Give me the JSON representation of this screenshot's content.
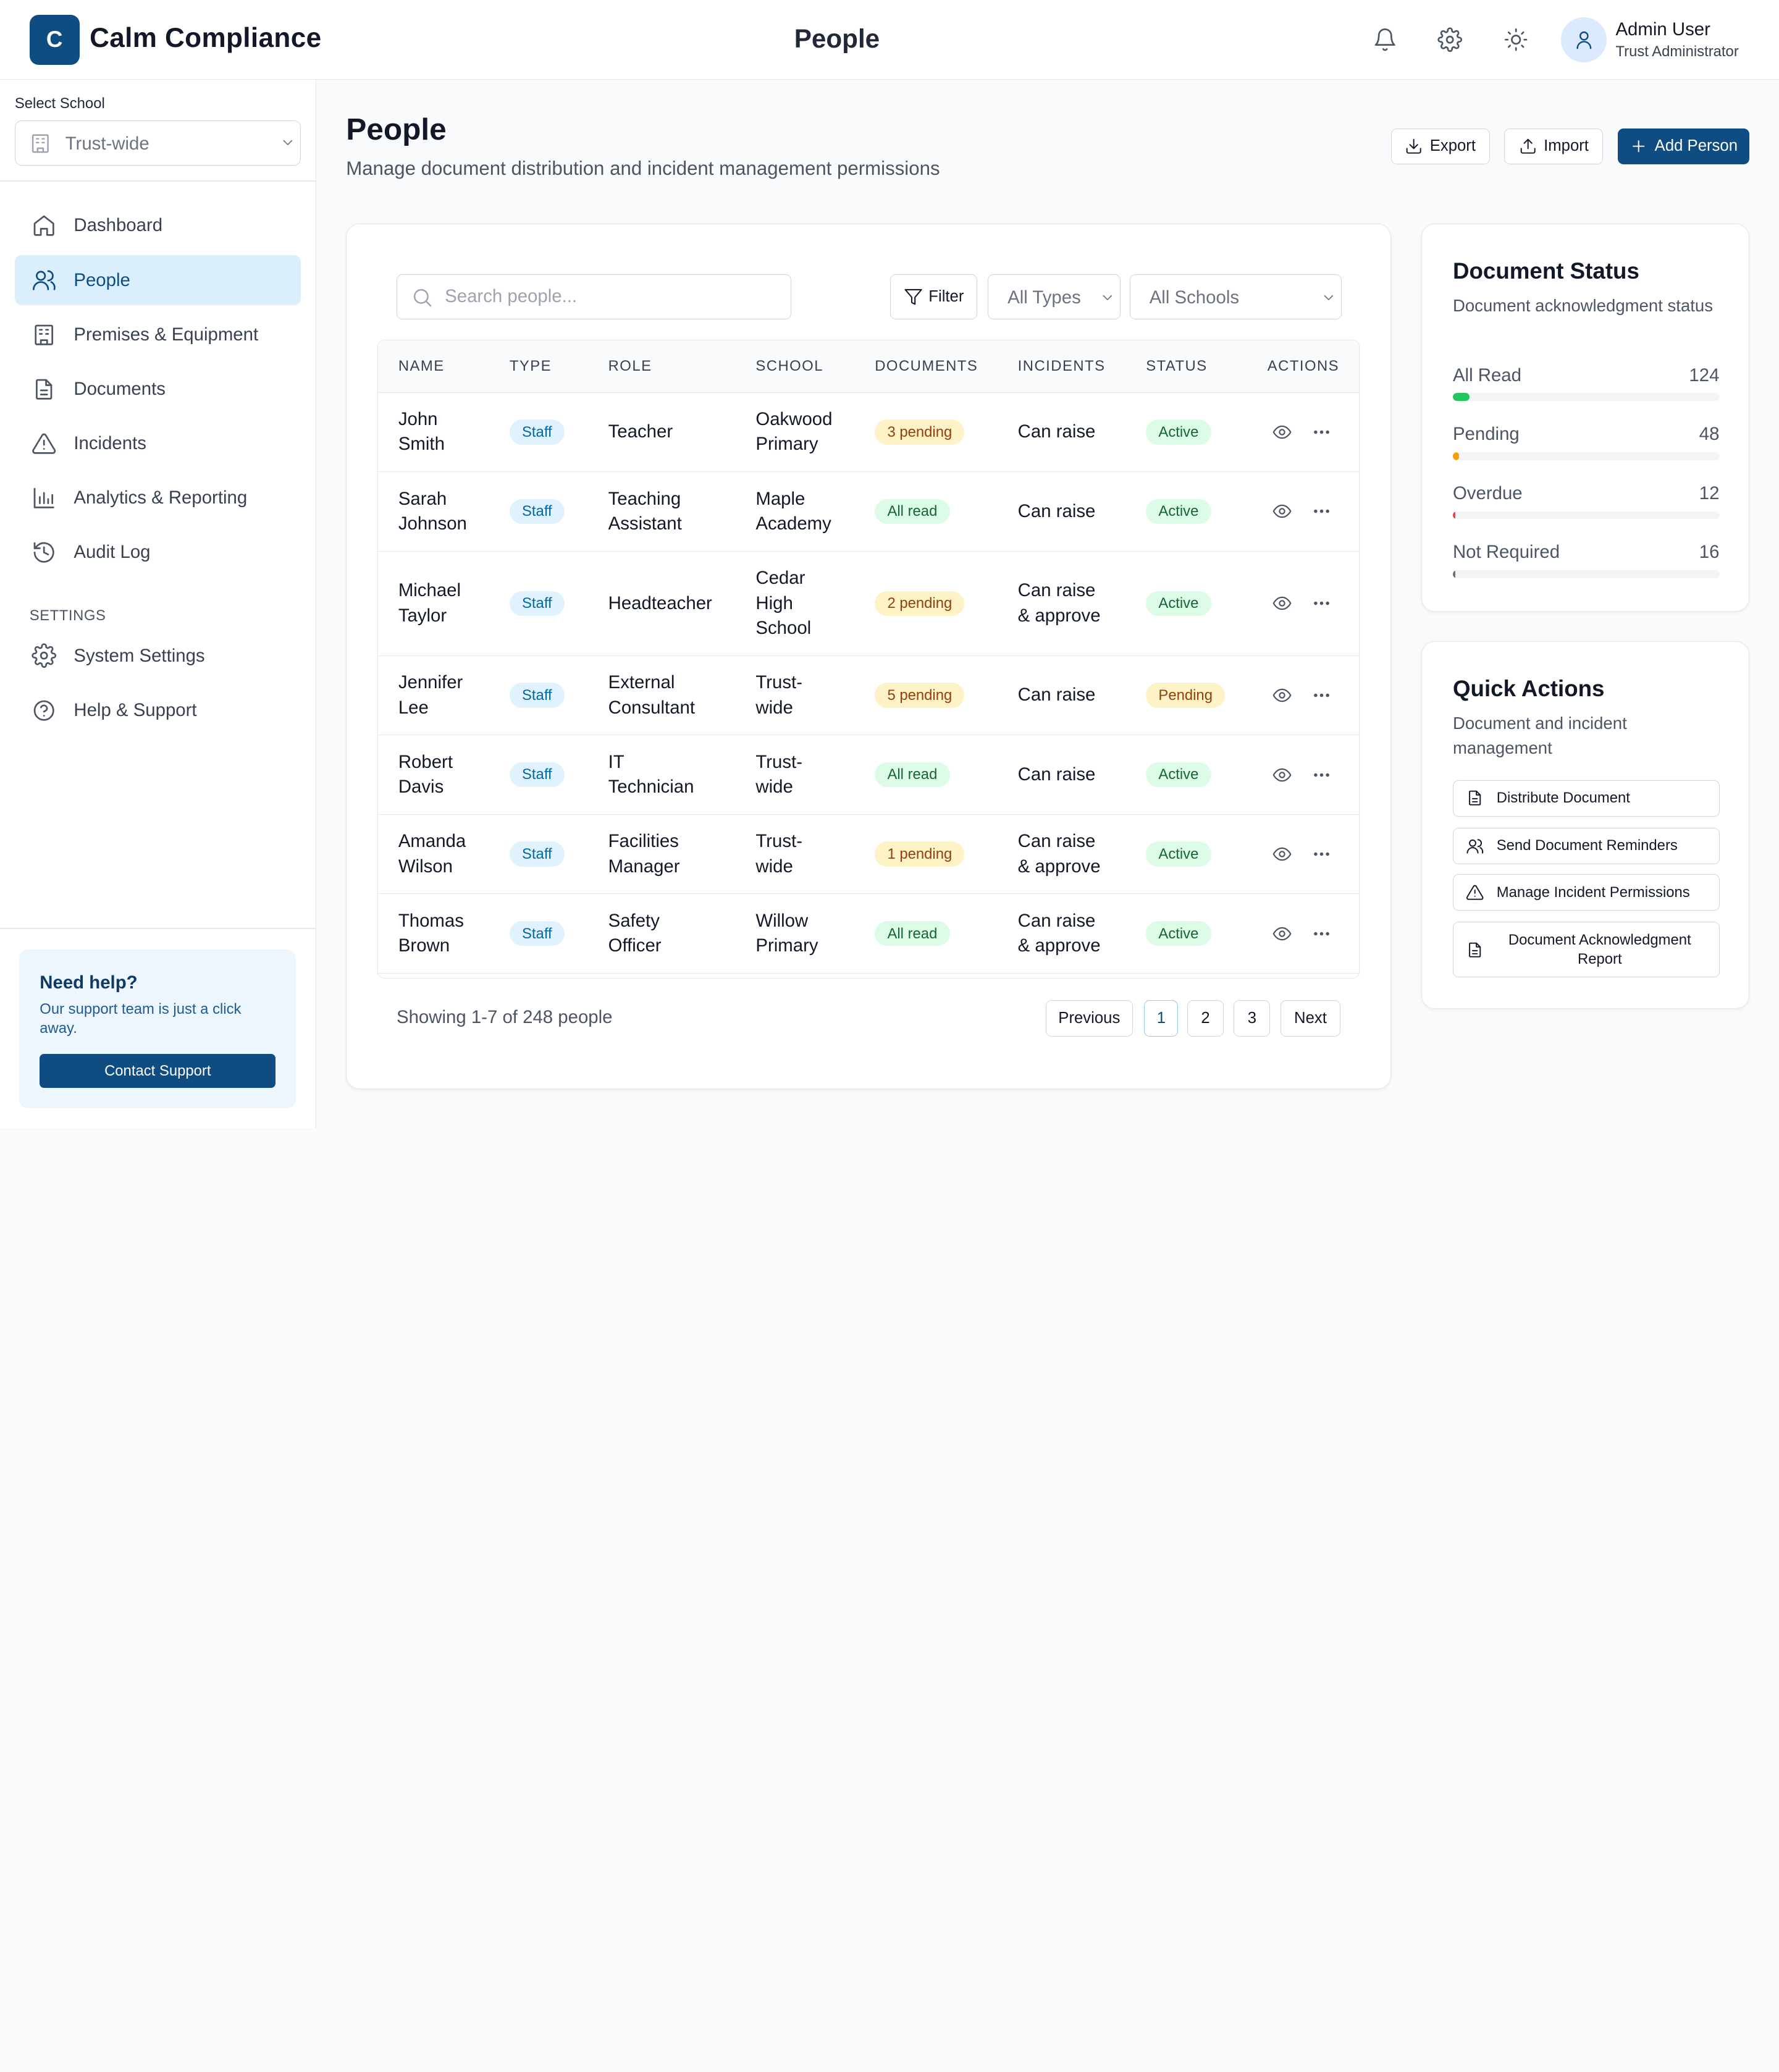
{
  "app": {
    "logo_letter": "C",
    "name": "Calm Compliance",
    "header_title": "People"
  },
  "user": {
    "name": "Admin User",
    "role": "Trust Administrator"
  },
  "sidebar": {
    "select_label": "Select School",
    "school_value": "Trust-wide",
    "nav": [
      {
        "label": "Dashboard",
        "icon": "home-icon",
        "active": false
      },
      {
        "label": "People",
        "icon": "users-icon",
        "active": true
      },
      {
        "label": "Premises & Equipment",
        "icon": "building-icon",
        "active": false
      },
      {
        "label": "Documents",
        "icon": "document-icon",
        "active": false
      },
      {
        "label": "Incidents",
        "icon": "warning-icon",
        "active": false
      },
      {
        "label": "Analytics & Reporting",
        "icon": "bar-chart-icon",
        "active": false
      },
      {
        "label": "Audit Log",
        "icon": "history-icon",
        "active": false
      }
    ],
    "settings_heading": "SETTINGS",
    "settings_nav": [
      {
        "label": "System Settings",
        "icon": "gear-icon"
      },
      {
        "label": "Help & Support",
        "icon": "help-icon"
      }
    ],
    "help": {
      "title": "Need help?",
      "text": "Our support team is just a click away.",
      "button": "Contact Support"
    }
  },
  "main": {
    "title": "People",
    "subtitle": "Manage document distribution and incident management permissions",
    "buttons": {
      "export": "Export",
      "import": "Import",
      "add": "Add Person"
    }
  },
  "table": {
    "search_placeholder": "Search people...",
    "filter_label": "Filter",
    "type_filter": "All Types",
    "school_filter": "All Schools",
    "headers": [
      "NAME",
      "TYPE",
      "ROLE",
      "SCHOOL",
      "DOCUMENTS",
      "INCIDENTS",
      "STATUS",
      "ACTIONS"
    ],
    "rows": [
      {
        "name": [
          "John",
          "Smith"
        ],
        "type": "Staff",
        "role": [
          "Teacher"
        ],
        "school": [
          "Oakwood",
          "Primary"
        ],
        "documents": "3 pending",
        "doc_state": "pending",
        "incidents": [
          "Can raise"
        ],
        "status": "Active"
      },
      {
        "name": [
          "Sarah",
          "Johnson"
        ],
        "type": "Staff",
        "role": [
          "Teaching",
          "Assistant"
        ],
        "school": [
          "Maple",
          "Academy"
        ],
        "documents": "All read",
        "doc_state": "read",
        "incidents": [
          "Can raise"
        ],
        "status": "Active"
      },
      {
        "name": [
          "Michael",
          "Taylor"
        ],
        "type": "Staff",
        "role": [
          "Headteacher"
        ],
        "school": [
          "Cedar",
          "High",
          "School"
        ],
        "documents": "2 pending",
        "doc_state": "pending",
        "incidents": [
          "Can raise",
          "& approve"
        ],
        "status": "Active"
      },
      {
        "name": [
          "Jennifer",
          "Lee"
        ],
        "type": "Staff",
        "role": [
          "External",
          "Consultant"
        ],
        "school": [
          "Trust-",
          "wide"
        ],
        "documents": "5 pending",
        "doc_state": "pending",
        "incidents": [
          "Can raise"
        ],
        "status": "Pending"
      },
      {
        "name": [
          "Robert",
          "Davis"
        ],
        "type": "Staff",
        "role": [
          "IT",
          "Technician"
        ],
        "school": [
          "Trust-",
          "wide"
        ],
        "documents": "All read",
        "doc_state": "read",
        "incidents": [
          "Can raise"
        ],
        "status": "Active"
      },
      {
        "name": [
          "Amanda",
          "Wilson"
        ],
        "type": "Staff",
        "role": [
          "Facilities",
          "Manager"
        ],
        "school": [
          "Trust-",
          "wide"
        ],
        "documents": "1 pending",
        "doc_state": "pending",
        "incidents": [
          "Can raise",
          "& approve"
        ],
        "status": "Active"
      },
      {
        "name": [
          "Thomas",
          "Brown"
        ],
        "type": "Staff",
        "role": [
          "Safety",
          "Officer"
        ],
        "school": [
          "Willow",
          "Primary"
        ],
        "documents": "All read",
        "doc_state": "read",
        "incidents": [
          "Can raise",
          "& approve"
        ],
        "status": "Active"
      }
    ],
    "showing": "Showing 1-7 of 248 people",
    "pagination": {
      "previous": "Previous",
      "pages": [
        "1",
        "2",
        "3"
      ],
      "current": "1",
      "next": "Next"
    }
  },
  "doc_status": {
    "title": "Document Status",
    "subtitle": "Document acknowledgment status",
    "stats": [
      {
        "label": "All Read",
        "value": "124",
        "fraction": 0.062,
        "color": "#22c55e"
      },
      {
        "label": "Pending",
        "value": "48",
        "fraction": 0.024,
        "color": "#f59e0b"
      },
      {
        "label": "Overdue",
        "value": "12",
        "fraction": 0.006,
        "color": "#ef4444"
      },
      {
        "label": "Not Required",
        "value": "16",
        "fraction": 0.008,
        "color": "#6b7280"
      }
    ]
  },
  "quick_actions": {
    "title": "Quick Actions",
    "subtitle": "Document and incident management",
    "items": [
      {
        "label": "Distribute Document",
        "icon": "document-icon"
      },
      {
        "label": "Send Document Reminders",
        "icon": "users-icon"
      },
      {
        "label": "Manage Incident Permissions",
        "icon": "warning-icon"
      },
      {
        "label": "Document Acknowledgment Report",
        "icon": "document-icon"
      }
    ]
  }
}
